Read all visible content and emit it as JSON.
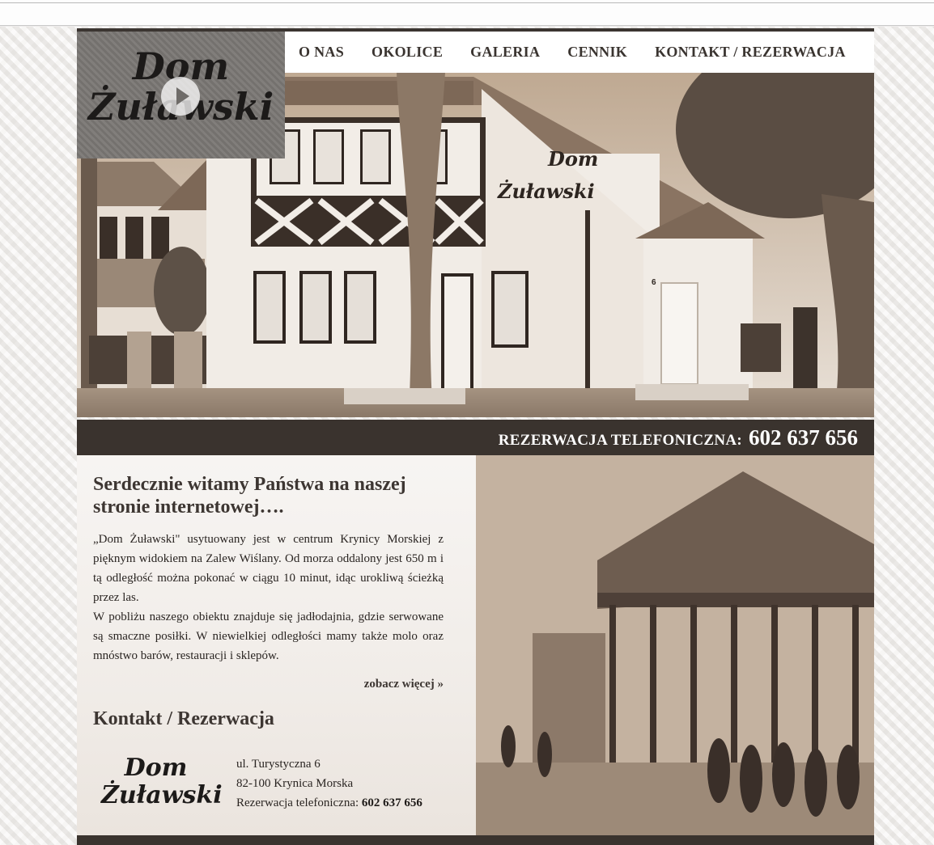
{
  "nav": {
    "items": [
      "O NAS",
      "OKOLICE",
      "GALERIA",
      "CENNIK",
      "KONTAKT / REZERWACJA"
    ]
  },
  "logo": {
    "line1": "Dom",
    "line2": "Żuławski"
  },
  "hero": {
    "sign_line1": "Dom",
    "sign_line2": "Żuławski",
    "house_number": "6"
  },
  "phone_bar": {
    "label": "REZERWACJA TELEFONICZNA:",
    "number": "602 637 656"
  },
  "welcome": {
    "title": "Serdecznie witamy Państwa na naszej stronie internetowej….",
    "paragraph1": "„Dom Żuławski\" usytuowany jest w centrum Krynicy Morskiej z pięknym widokiem na Zalew Wiślany. Od morza oddalony jest 650 m i tą odległość można pokonać w ciągu 10 minut, idąc urokliwą ścieżką przez las.",
    "paragraph2": "W pobliżu naszego obiektu znajduje się jadłodajnia, gdzie serwowane są smaczne posiłki. W niewielkiej odległości mamy także molo oraz mnóstwo barów, restauracji i sklepów.",
    "more_link": "zobacz więcej »"
  },
  "contact": {
    "title": "Kontakt / Rezerwacja",
    "logo_line1": "Dom",
    "logo_line2": "Żuławski",
    "street": "ul. Turystyczna 6",
    "city": "82-100 Krynica Morska",
    "phone_label": "Rezerwacja telefoniczna:",
    "phone_number": "602 637 656"
  },
  "colors": {
    "dark_brown": "#3a332e",
    "logo_box": "#7a7774",
    "text": "#3d3632"
  }
}
